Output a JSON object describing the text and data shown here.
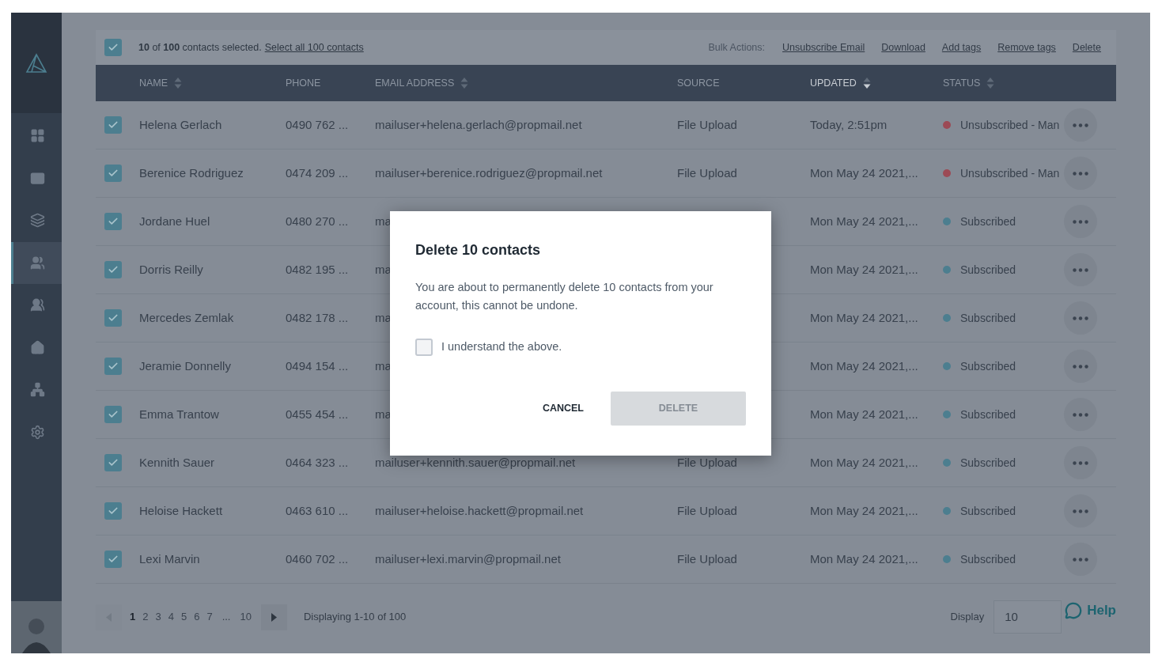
{
  "sidebar": {
    "items": [
      {
        "selected": false
      },
      {
        "selected": false
      },
      {
        "selected": false
      },
      {
        "selected": true
      },
      {
        "selected": false
      },
      {
        "selected": false
      },
      {
        "selected": false
      },
      {
        "selected": false
      }
    ]
  },
  "toolbar": {
    "all_checked": true,
    "selection_text": "**10** of **100** contacts selected.",
    "select_all_link": "Select all 100 contacts",
    "bulk_label": "Bulk Actions:",
    "bulk_actions": [
      "Unsubscribe Email",
      "Download",
      "Add tags",
      "Remove tags",
      "Delete"
    ]
  },
  "table": {
    "columns": [
      {
        "label": "NAME",
        "sortable": true,
        "sorted": false
      },
      {
        "label": "PHONE",
        "sortable": false,
        "sorted": false
      },
      {
        "label": "EMAIL ADDRESS",
        "sortable": true,
        "sorted": false
      },
      {
        "label": "SOURCE",
        "sortable": false,
        "sorted": false
      },
      {
        "label": "UPDATED",
        "sortable": true,
        "sorted": true
      },
      {
        "label": "STATUS",
        "sortable": true,
        "sorted": false
      }
    ],
    "rows": [
      {
        "checked": true,
        "name": "Helena Gerlach",
        "phone": "0490 762 ...",
        "email": "mailuser+helena.gerlach@propmail.net",
        "source": "File Upload",
        "updated": "Today, 2:51pm",
        "status": "Unsubscribed - Man",
        "color": "#9c4a55"
      },
      {
        "checked": true,
        "name": "Berenice Rodriguez",
        "phone": "0474 209 ...",
        "email": "mailuser+berenice.rodriguez@propmail.net",
        "source": "File Upload",
        "updated": "Mon May 24 2021,...",
        "status": "Unsubscribed - Man",
        "color": "#9c4a55"
      },
      {
        "checked": true,
        "name": "Jordane Huel",
        "phone": "0480 270 ...",
        "email": "ma",
        "updated": "Mon May 24 2021,...",
        "status": "Subscribed",
        "color": "#4c7e8f"
      },
      {
        "checked": true,
        "name": "Dorris Reilly",
        "phone": "0482 195 ...",
        "email": "ma",
        "updated": "Mon May 24 2021,...",
        "status": "Subscribed",
        "color": "#4c7e8f"
      },
      {
        "checked": true,
        "name": "Mercedes Zemlak",
        "phone": "0482 178 ...",
        "email": "ma",
        "updated": "Mon May 24 2021,...",
        "status": "Subscribed",
        "color": "#4c7e8f"
      },
      {
        "checked": true,
        "name": "Jeramie Donnelly",
        "phone": "0494 154 ...",
        "email": "ma",
        "updated": "Mon May 24 2021,...",
        "status": "Subscribed",
        "color": "#4c7e8f"
      },
      {
        "checked": true,
        "name": "Emma Trantow",
        "phone": "0455 454 ...",
        "email": "ma",
        "updated": "Mon May 24 2021,...",
        "status": "Subscribed",
        "color": "#4c7e8f"
      },
      {
        "checked": true,
        "name": "Kennith Sauer",
        "phone": "0464 323 ...",
        "email": "mailuser+kennith.sauer@propmail.net",
        "source": "File Upload",
        "updated": "Mon May 24 2021,...",
        "status": "Subscribed",
        "color": "#4c7e8f"
      },
      {
        "checked": true,
        "name": "Heloise Hackett",
        "phone": "0463 610 ...",
        "email": "mailuser+heloise.hackett@propmail.net",
        "source": "File Upload",
        "updated": "Mon May 24 2021,...",
        "status": "Subscribed",
        "color": "#4c7e8f"
      },
      {
        "checked": true,
        "name": "Lexi Marvin",
        "phone": "0460 702 ...",
        "email": "mailuser+lexi.marvin@propmail.net",
        "source": "File Upload",
        "updated": "Mon May 24 2021,...",
        "status": "Subscribed",
        "color": "#4c7e8f"
      }
    ]
  },
  "pagination": {
    "prev_disabled": true,
    "next_disabled": false,
    "pages": [
      {
        "label": "1",
        "kind": "page",
        "selected": true
      },
      {
        "label": "2",
        "kind": "page",
        "selected": false
      },
      {
        "label": "3",
        "kind": "page",
        "selected": false
      },
      {
        "label": "4",
        "kind": "page",
        "selected": false
      },
      {
        "label": "5",
        "kind": "page",
        "selected": false
      },
      {
        "label": "6",
        "kind": "page",
        "selected": false
      },
      {
        "label": "7",
        "kind": "page",
        "selected": false
      },
      {
        "label": "...",
        "kind": "gap"
      },
      {
        "label": "10",
        "kind": "page",
        "selected": false
      }
    ],
    "info": "Displaying 1-10 of 100",
    "display_label": "Display",
    "display_value": "10"
  },
  "help": {
    "label": "Help"
  },
  "dialog": {
    "title": "Delete 10 contacts",
    "message": "You are about to permanently delete 10 contacts from your account, this cannot be undone.",
    "confirm_label": "I understand the above.",
    "confirm_checked": false,
    "cancel": "CANCEL",
    "delete": {
      "label": "DELETE",
      "disabled": true
    }
  }
}
